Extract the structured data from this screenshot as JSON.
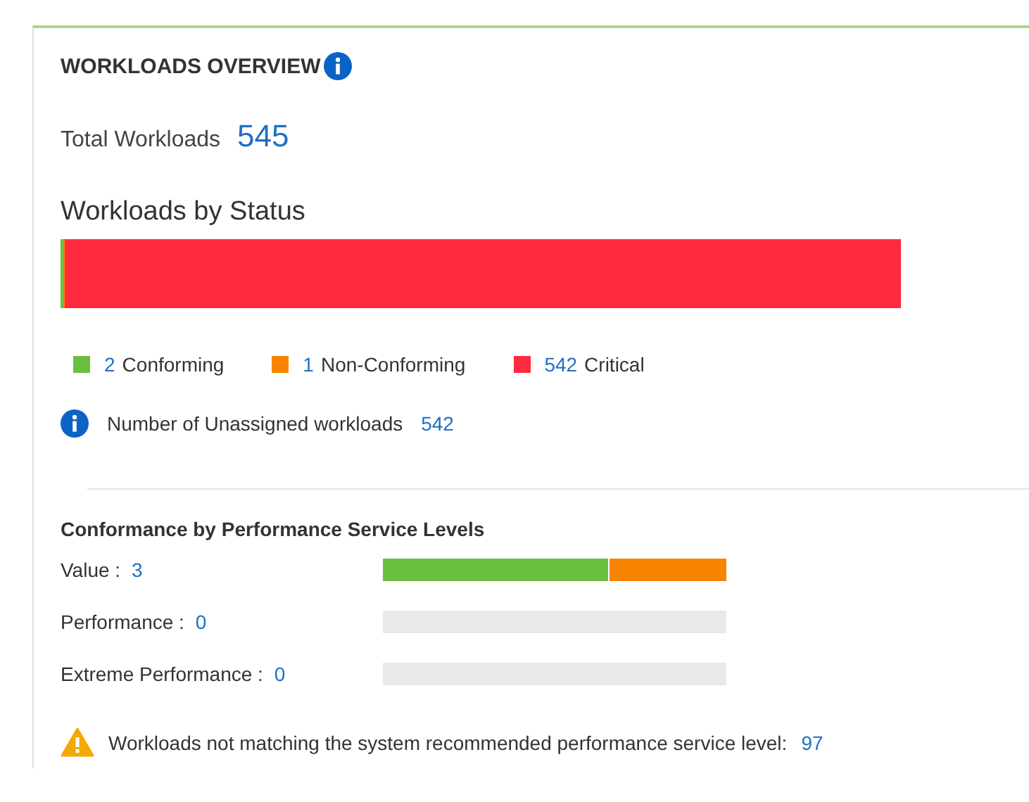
{
  "title": "WORKLOADS OVERVIEW",
  "total": {
    "label": "Total Workloads",
    "value": "545"
  },
  "status": {
    "title": "Workloads by Status",
    "segments": [
      {
        "count": "2",
        "label": "Conforming",
        "color": "#6abf40",
        "level": 0.0037
      },
      {
        "count": "1",
        "label": "Non-Conforming",
        "color": "#f78400",
        "level": 0.0018
      },
      {
        "count": "542",
        "label": "Critical",
        "color": "#fe2a3f",
        "level": 0.9945
      }
    ]
  },
  "unassigned": {
    "label": "Number of Unassigned workloads",
    "value": "542"
  },
  "psl": {
    "title": "Conformance by Performance Service Levels",
    "rows": [
      {
        "label": "Value :",
        "value": "3",
        "segments": [
          {
            "color": "#6abf40",
            "level": 0.66
          },
          {
            "color": "#f78400",
            "level": 0.34
          }
        ]
      },
      {
        "label": "Performance :",
        "value": "0"
      },
      {
        "label": "Extreme Performance :",
        "value": "0"
      }
    ]
  },
  "warning": {
    "label": "Workloads not matching the system recommended performance service level:",
    "value": "97"
  }
}
